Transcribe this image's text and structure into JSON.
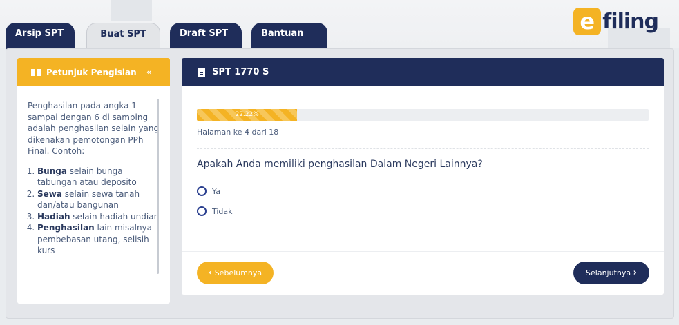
{
  "tabs": [
    {
      "label": "Arsip SPT"
    },
    {
      "label": "Buat SPT"
    },
    {
      "label": "Draft SPT"
    },
    {
      "label": "Bantuan"
    }
  ],
  "logo": {
    "letter": "e",
    "text": "filing"
  },
  "sidebar": {
    "title": "Petunjuk Pengisian",
    "collapse_icon": "«",
    "intro": "Penghasilan pada angka 1 sampai dengan 6 di samping adalah penghasilan selain yang dikenakan pemotongan PPh Final. Contoh:",
    "items": [
      {
        "bold": "Bunga",
        "rest": " selain bunga tabungan atau deposito"
      },
      {
        "bold": "Sewa",
        "rest": " selain sewa tanah dan/atau bangunan"
      },
      {
        "bold": "Hadiah",
        "rest": " selain hadiah undian"
      },
      {
        "bold": "Penghasilan",
        "rest": " lain misalnya pembebasan utang, selisih kurs"
      }
    ]
  },
  "card": {
    "title": "SPT 1770 S",
    "progress_label": "22.22%",
    "progress_value": 22.22,
    "page_info": "Halaman ke 4 dari 18",
    "question": "Apakah Anda memiliki penghasilan Dalam Negeri Lainnya?",
    "options": [
      "Ya",
      "Tidak"
    ],
    "prev_label": "Sebelumnya",
    "next_label": "Selanjutnya"
  },
  "colors": {
    "navy": "#1f2d5a",
    "accent": "#f4b324"
  }
}
